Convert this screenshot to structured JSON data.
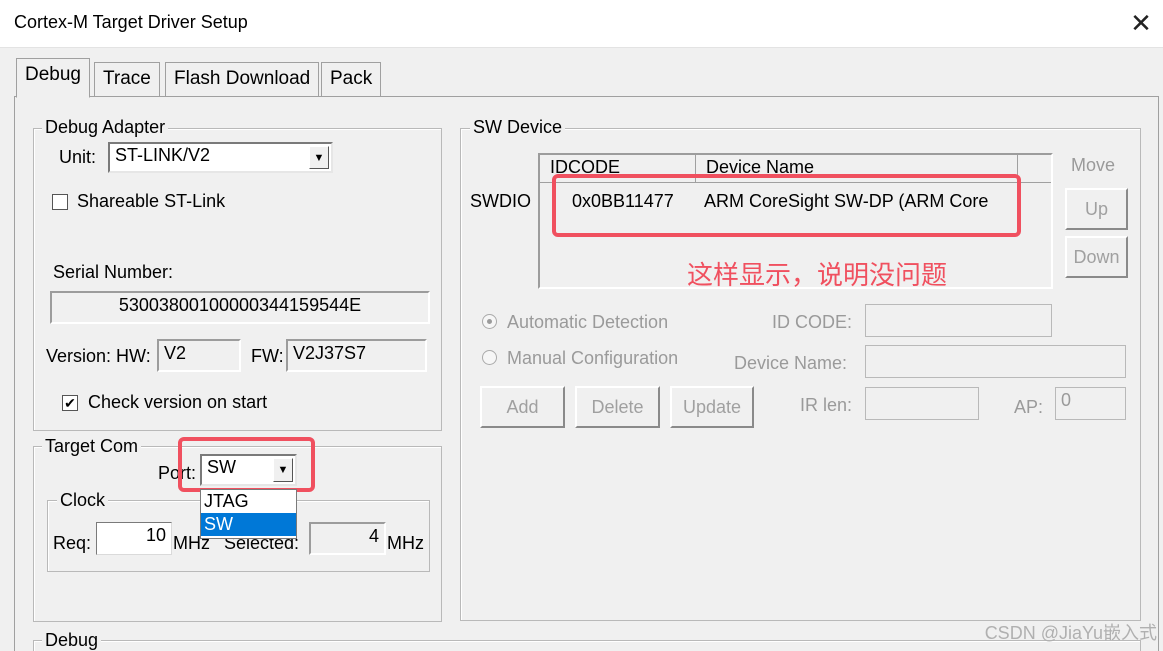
{
  "window": {
    "title": "Cortex-M Target Driver Setup",
    "close": "✕"
  },
  "tabs": [
    "Debug",
    "Trace",
    "Flash Download",
    "Pack"
  ],
  "debug_adapter": {
    "title": "Debug Adapter",
    "unit_label": "Unit:",
    "unit_value": "ST-LINK/V2",
    "shareable_label": "Shareable ST-Link",
    "shareable_checked": false,
    "serial_label": "Serial Number:",
    "serial_value": "53003800100000344159544E",
    "version_label": "Version: HW:",
    "hw_value": "V2",
    "fw_label": "FW:",
    "fw_value": "V2J37S7",
    "check_version_label": "Check version on start",
    "check_version_checked": true
  },
  "target_com": {
    "title": "Target Com",
    "port_label": "Port:",
    "port_value": "SW",
    "port_options": [
      "JTAG",
      "SW"
    ],
    "port_selected": "SW",
    "clock": {
      "title": "Clock",
      "req_label": "Req:",
      "req_value": "10",
      "req_unit": "MHz",
      "selected_label": "Selected:",
      "selected_value": "4",
      "selected_unit": "MHz"
    }
  },
  "debug_group_title": "Debug",
  "sw_device": {
    "title": "SW Device",
    "swdio_label": "SWDIO",
    "columns": [
      "IDCODE",
      "Device Name"
    ],
    "rows": [
      {
        "idcode": "0x0BB11477",
        "device_name": "ARM CoreSight SW-DP (ARM Core"
      }
    ],
    "move_label": "Move",
    "up_label": "Up",
    "down_label": "Down",
    "auto_detect_label": "Automatic Detection",
    "manual_config_label": "Manual Configuration",
    "id_code_label": "ID CODE:",
    "device_name_label": "Device Name:",
    "add_label": "Add",
    "delete_label": "Delete",
    "update_label": "Update",
    "ir_len_label": "IR len:",
    "ap_label": "AP:",
    "ap_value": "0"
  },
  "annotation": "这样显示，说明没问题",
  "watermark": "CSDN @JiaYu嵌入式",
  "colors": {
    "highlight": "#f0505f",
    "selection": "#0078d7"
  }
}
